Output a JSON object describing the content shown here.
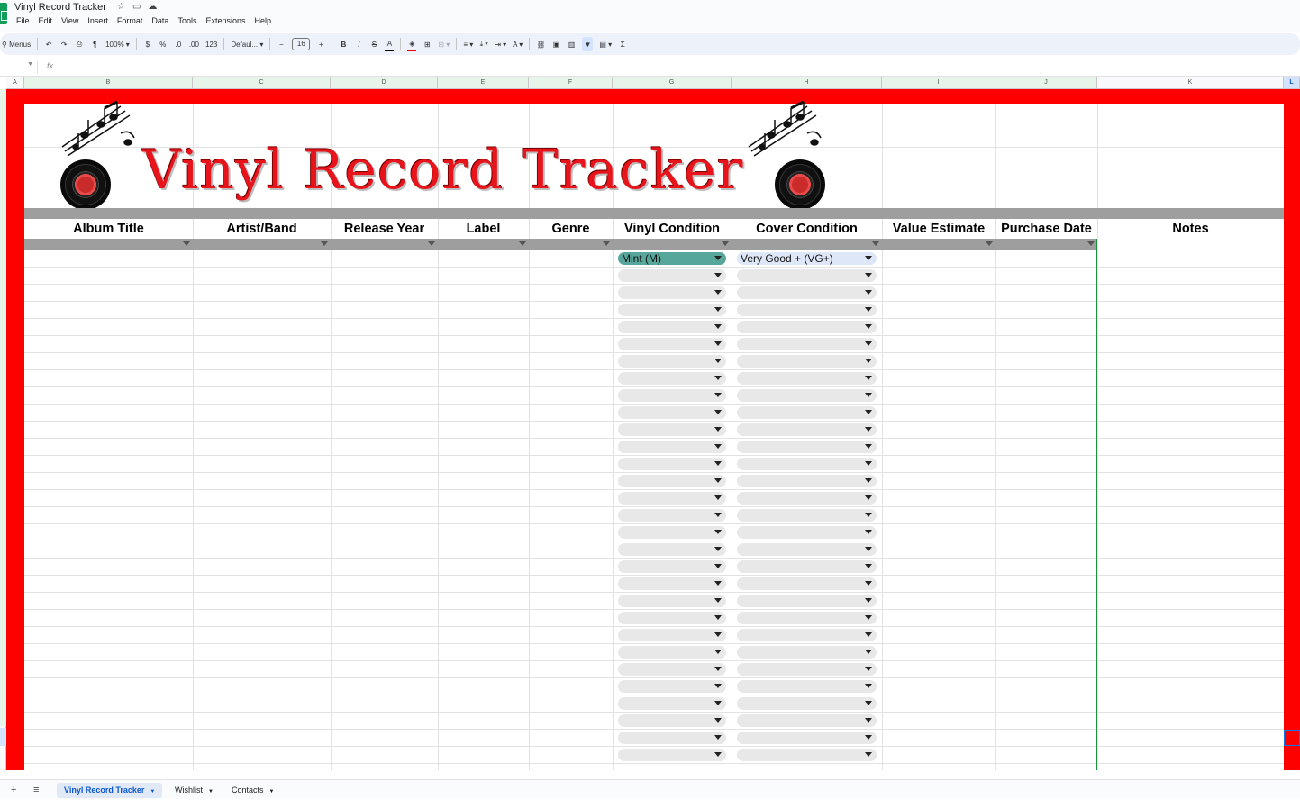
{
  "app": {
    "doc_title": "Vinyl Record Tracker",
    "title_icons": [
      "star-icon",
      "folder-move-icon",
      "cloud-status-icon"
    ],
    "menu": [
      "File",
      "Edit",
      "View",
      "Insert",
      "Format",
      "Data",
      "Tools",
      "Extensions",
      "Help"
    ]
  },
  "toolbar": {
    "search_label": "Menus",
    "zoom": "100%",
    "currency": "$",
    "percent": "%",
    "dec_decrease": ".0",
    "dec_increase": ".00",
    "number_format": "123",
    "font": "Defaul...",
    "minus": "−",
    "font_size": "16",
    "plus": "+",
    "bold": "B",
    "italic": "I",
    "strike": "S",
    "text_color": "A",
    "sum": "Σ"
  },
  "formula_bar": {
    "fx": "fx"
  },
  "columns": [
    "A",
    "B",
    "C",
    "D",
    "E",
    "F",
    "G",
    "H",
    "I",
    "J",
    "K",
    "L"
  ],
  "banner": {
    "title": "Vinyl Record Tracker"
  },
  "headers": [
    "Album Title",
    "Artist/Band",
    "Release Year",
    "Label",
    "Genre",
    "Vinyl Condition",
    "Cover Condition",
    "Value Estimate",
    "Purchase Date",
    "Notes"
  ],
  "dropdowns": {
    "vinyl_condition_first": "Mint (M)",
    "cover_condition_first": "Very Good + (VG+)",
    "empty_rows": 30
  },
  "colors": {
    "frame": "#ff0000",
    "title": "#e8141b",
    "header_band": "#9e9e9e",
    "mint_chip": "#56a69b",
    "vg_chip": "#dde7f8"
  },
  "sheets": {
    "tabs": [
      "Vinyl Record Tracker",
      "Wishlist",
      "Contacts"
    ],
    "active": "Vinyl Record Tracker",
    "add_icon": "+",
    "all_sheets_icon": "≡"
  }
}
